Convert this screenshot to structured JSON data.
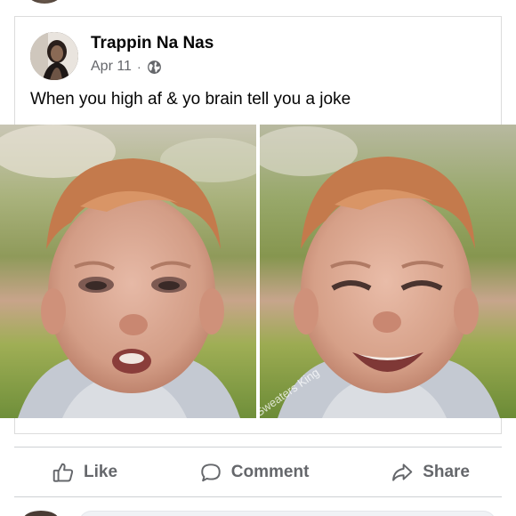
{
  "post": {
    "author": "Trappin Na Nas",
    "date": "Apr 11",
    "separator": "·",
    "privacy_icon": "globe-icon",
    "text": "When you high af & yo brain tell you a joke"
  },
  "meme": {
    "watermark": "Sweaters King"
  },
  "actions": {
    "like_label": "Like",
    "like_icon": "thumbs-up-icon",
    "comment_label": "Comment",
    "comment_icon": "speech-bubble-icon",
    "share_label": "Share",
    "share_icon": "share-arrow-icon"
  },
  "colors": {
    "name_text": "#050505",
    "secondary_text": "#65676b",
    "divider": "#ced0d4"
  }
}
